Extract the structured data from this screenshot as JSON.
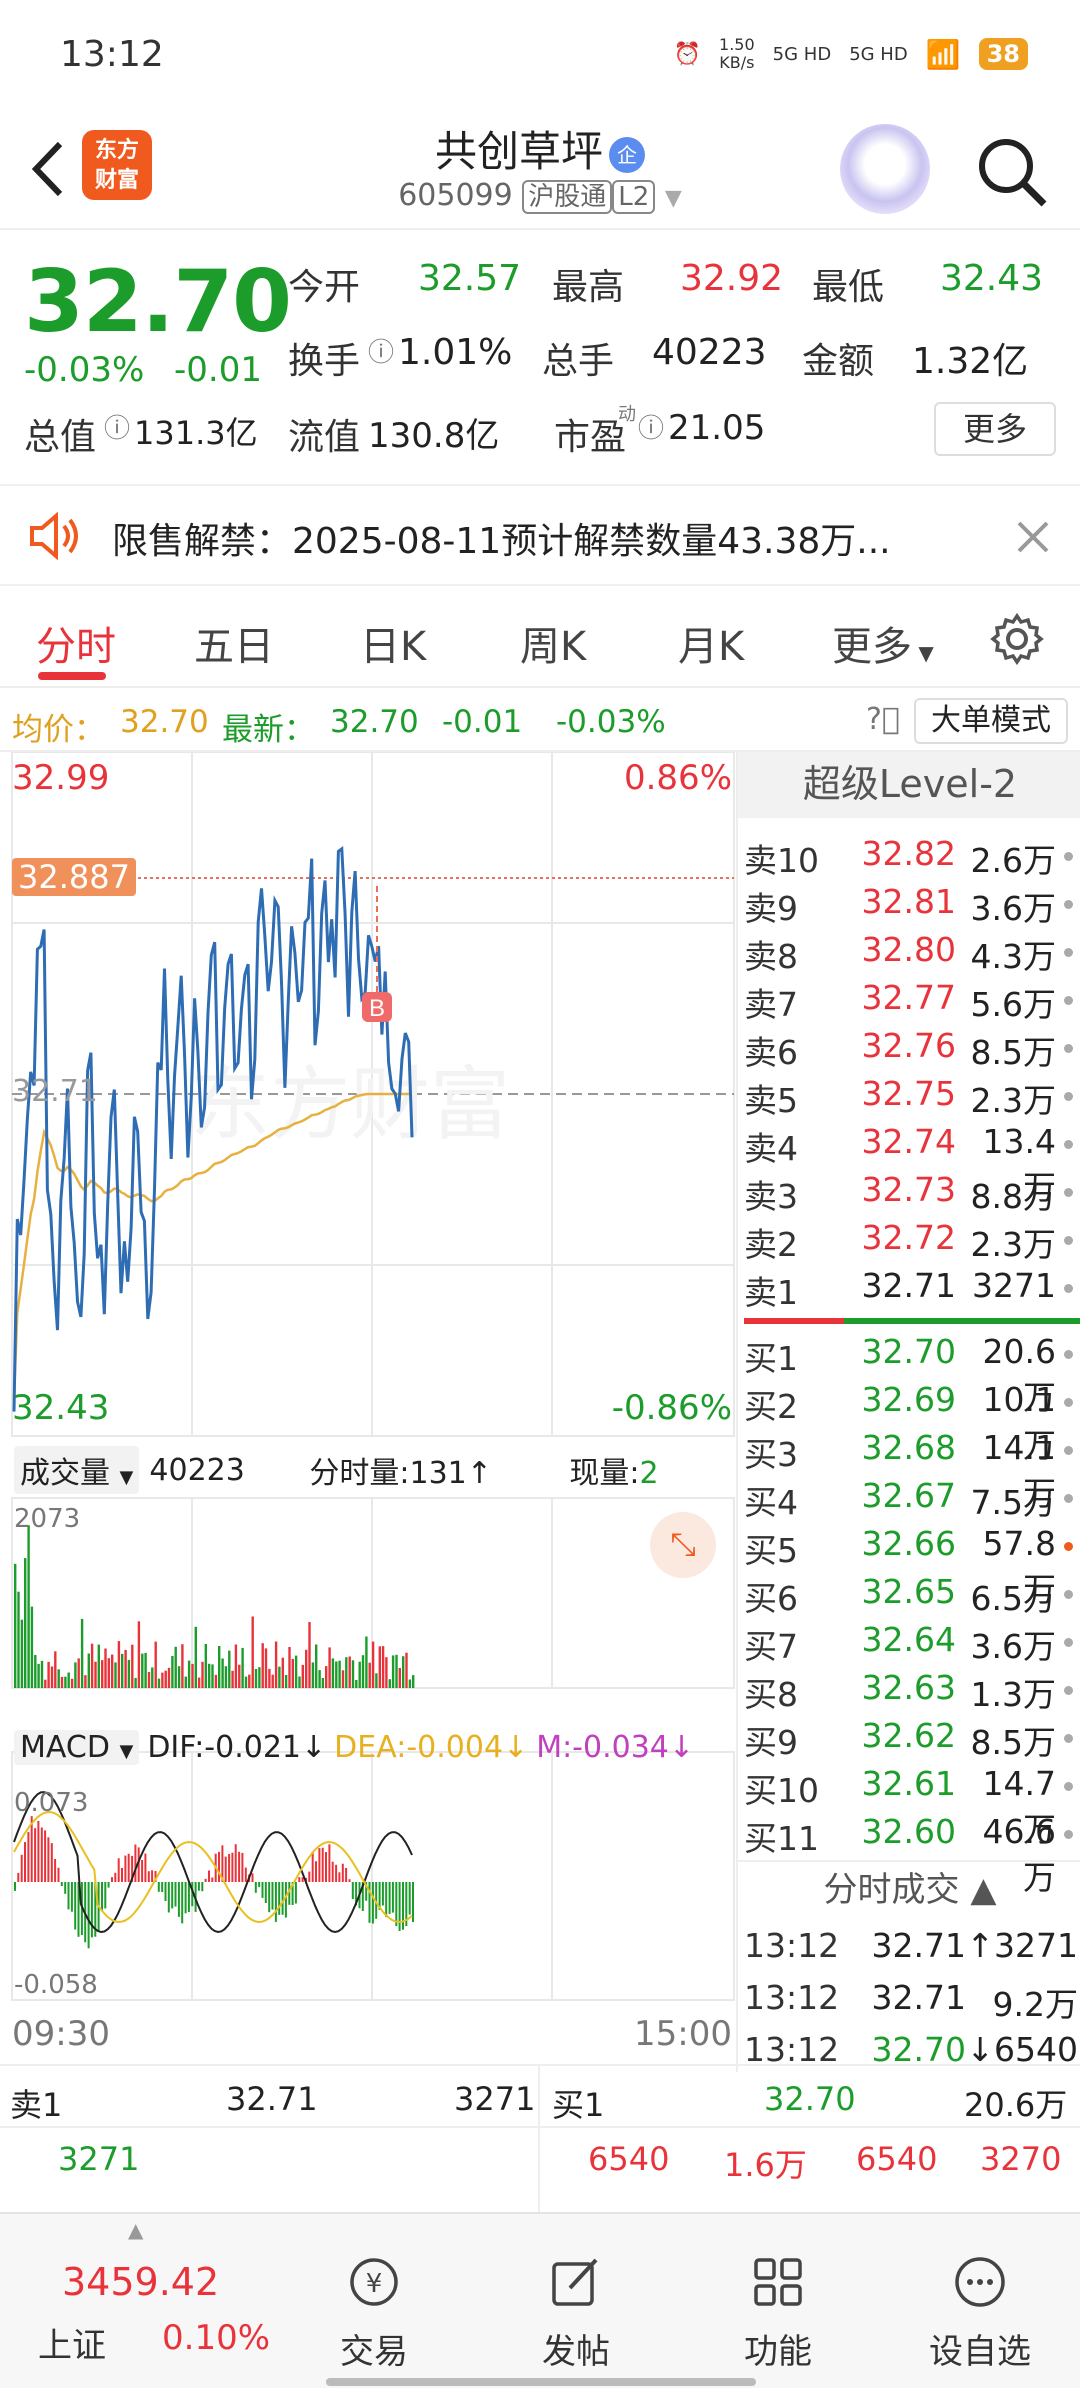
{
  "status": {
    "time": "13:12",
    "speed": "1.50",
    "speed_unit": "KB/s",
    "net1": "5G HD",
    "net2": "5G HD",
    "battery": "38"
  },
  "header": {
    "logo_text": "东方财富",
    "name": "共创草坪",
    "badge": "企",
    "code": "605099",
    "tag1": "沪股通",
    "tag2": "L2"
  },
  "quote": {
    "price": "32.70",
    "change_pct": "-0.03%",
    "change": "-0.01",
    "open_label": "今开",
    "open": "32.57",
    "high_label": "最高",
    "high": "32.92",
    "low_label": "最低",
    "low": "32.43",
    "turnover_label": "换手",
    "turnover": "1.01%",
    "volume_label": "总手",
    "volume": "40223",
    "amount_label": "金额",
    "amount": "1.32亿",
    "mktcap_label": "总值",
    "mktcap": "131.3亿",
    "float_label": "流值",
    "float": "130.8亿",
    "pe_label": "市盈",
    "pe_sup": "动",
    "pe": "21.05",
    "more": "更多"
  },
  "notice": {
    "text": "限售解禁：2025-08-11预计解禁数量43.38万..."
  },
  "tabs": [
    "分时",
    "五日",
    "日K",
    "周K",
    "月K",
    "更多"
  ],
  "info": {
    "avg_label": "均价：",
    "avg": "32.70",
    "latest_label": "最新：",
    "latest": "32.70",
    "chg": "-0.01",
    "pct": "-0.03%",
    "mode_btn": "大单模式"
  },
  "chart": {
    "top_price": "32.99",
    "top_pct": "0.86%",
    "bottom_price": "32.43",
    "bottom_pct": "-0.86%",
    "mid_price": "32.71",
    "marker_price": "32.887",
    "marker_b": "B",
    "vol_label": "成交量",
    "vol_total": "40223",
    "vol_period": "分时量:131",
    "vol_now_label": "现量:",
    "vol_now": "2",
    "vol_max": "2073",
    "macd_label": "MACD",
    "dif": "DIF:-0.021",
    "dea": "DEA:-0.004",
    "m": "M:-0.034",
    "macd_top": "0.073",
    "macd_bottom": "-0.058",
    "time_start": "09:30",
    "time_end": "15:00",
    "watermark": "东方财富"
  },
  "order_book": {
    "title": "超级Level-2",
    "asks": [
      {
        "l": "卖10",
        "p": "32.82",
        "v": "2.6万"
      },
      {
        "l": "卖9",
        "p": "32.81",
        "v": "3.6万"
      },
      {
        "l": "卖8",
        "p": "32.80",
        "v": "4.3万"
      },
      {
        "l": "卖7",
        "p": "32.77",
        "v": "5.6万"
      },
      {
        "l": "卖6",
        "p": "32.76",
        "v": "8.5万"
      },
      {
        "l": "卖5",
        "p": "32.75",
        "v": "2.3万"
      },
      {
        "l": "卖4",
        "p": "32.74",
        "v": "13.4万"
      },
      {
        "l": "卖3",
        "p": "32.73",
        "v": "8.8万"
      },
      {
        "l": "卖2",
        "p": "32.72",
        "v": "2.3万"
      },
      {
        "l": "卖1",
        "p": "32.71",
        "v": "3271"
      }
    ],
    "bids": [
      {
        "l": "买1",
        "p": "32.70",
        "v": "20.6万"
      },
      {
        "l": "买2",
        "p": "32.69",
        "v": "10.1万"
      },
      {
        "l": "买3",
        "p": "32.68",
        "v": "14.1万"
      },
      {
        "l": "买4",
        "p": "32.67",
        "v": "7.5万"
      },
      {
        "l": "买5",
        "p": "32.66",
        "v": "57.8万"
      },
      {
        "l": "买6",
        "p": "32.65",
        "v": "6.5万"
      },
      {
        "l": "买7",
        "p": "32.64",
        "v": "3.6万"
      },
      {
        "l": "买8",
        "p": "32.63",
        "v": "1.3万"
      },
      {
        "l": "买9",
        "p": "32.62",
        "v": "8.5万"
      },
      {
        "l": "买10",
        "p": "32.61",
        "v": "14.7万"
      },
      {
        "l": "买11",
        "p": "32.60",
        "v": "46.6万"
      }
    ],
    "ticks_title": "分时成交",
    "ticks": [
      {
        "t": "13:12",
        "p": "32.71",
        "v": "3271",
        "dir": "↑"
      },
      {
        "t": "13:12",
        "p": "32.71",
        "v": "9.2万",
        "dir": ""
      },
      {
        "t": "13:12",
        "p": "32.70",
        "v": "6540",
        "dir": "↓"
      }
    ]
  },
  "bottom_trade": {
    "sell_label": "卖1",
    "sell_price": "32.71",
    "sell_vol": "3271",
    "buy_label": "买1",
    "buy_price": "32.70",
    "buy_vol": "20.6万",
    "sell_q": "3271",
    "buy_q": [
      "6540",
      "1.6万",
      "6540",
      "3270"
    ]
  },
  "navbar": {
    "index_value": "3459.42",
    "index_name": "上证",
    "index_pct": "0.10%",
    "items": [
      "交易",
      "发帖",
      "功能",
      "设自选"
    ]
  }
}
